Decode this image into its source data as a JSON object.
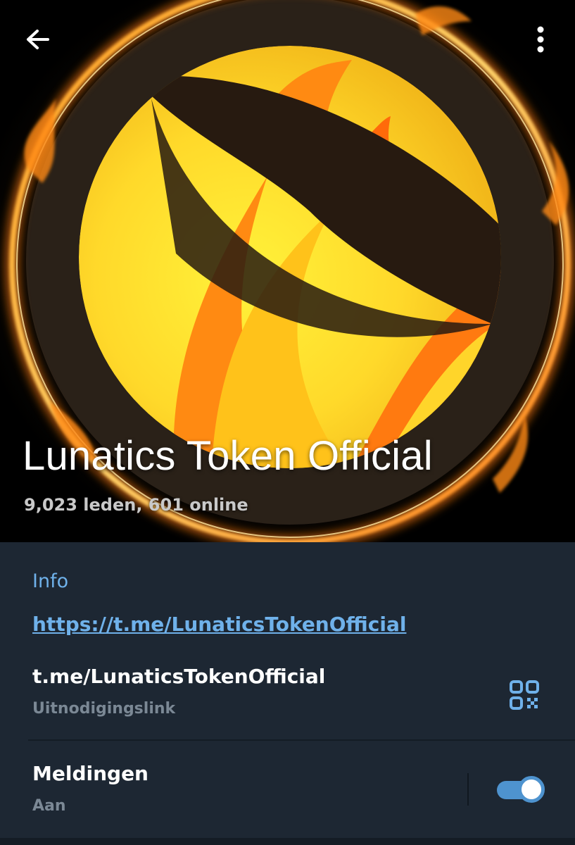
{
  "header": {
    "title": "Lunatics Token Official",
    "subtitle": "9,023 leden, 601 online",
    "back_icon": "arrow-left-icon",
    "menu_icon": "more-vertical-icon",
    "avatar": "terra-luna-logo-with-fire-ring"
  },
  "info": {
    "heading": "Info",
    "link": "https://t.me/LunaticsTokenOfficial",
    "invite": {
      "value": "t.me/LunaticsTokenOfficial",
      "label": "Uitnodigingslink",
      "icon": "qr-code-icon"
    },
    "notifications": {
      "title": "Meldingen",
      "status": "Aan",
      "enabled": true
    }
  },
  "colors": {
    "background": "#1d2733",
    "accent": "#6fb1ea",
    "toggle": "#4e93cf",
    "muted_text": "#7b8895"
  }
}
